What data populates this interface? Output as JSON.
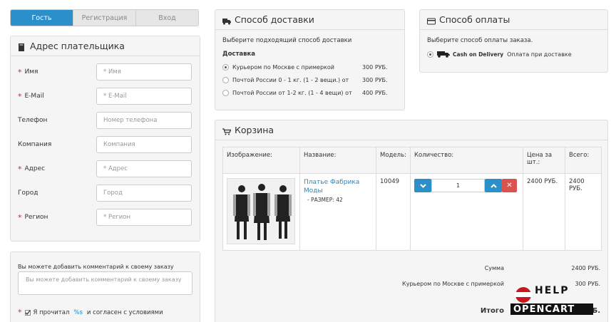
{
  "tabs": [
    "Гость",
    "Регистрация",
    "Вход"
  ],
  "payer": {
    "title": "Адрес плательщика",
    "fields": [
      {
        "label": "Имя",
        "required": true,
        "placeholder": "* Имя"
      },
      {
        "label": "E-Mail",
        "required": true,
        "placeholder": "* E-Mail"
      },
      {
        "label": "Телефон",
        "required": false,
        "placeholder": "Номер телефона"
      },
      {
        "label": "Компания",
        "required": false,
        "placeholder": "Компания"
      },
      {
        "label": "Адрес",
        "required": true,
        "placeholder": "* Адрес"
      },
      {
        "label": "Город",
        "required": false,
        "placeholder": "Город"
      },
      {
        "label": "Регион",
        "required": true,
        "placeholder": "* Регион"
      }
    ]
  },
  "comment": {
    "label": "Вы можете добавить комментарий к своему заказу",
    "placeholder": "Вы можете добавить комментарий к своему заказу",
    "agree_text": "Я прочитал",
    "agree_link": "%s",
    "agree_tail": "и согласен с условиями"
  },
  "delivery": {
    "title": "Способ доставки",
    "subtitle": "Выберите подходящий способ доставки",
    "group": "Доставка",
    "options": [
      {
        "label": "Курьером по Москве с примеркой",
        "price": "300 РУБ.",
        "selected": true
      },
      {
        "label": "Почтой России 0 - 1 кг. (1 - 2 вещи.) от",
        "price": "300 РУБ.",
        "selected": false
      },
      {
        "label": "Почтой России от 1-2 кг. (1 - 4 вещи) от",
        "price": "400 РУБ.",
        "selected": false
      }
    ]
  },
  "payment": {
    "title": "Способ оплаты",
    "subtitle": "Выберите способ оплаты заказа.",
    "option_logo": "Cash on Delivery",
    "option_label": "Оплата при доставке"
  },
  "cart": {
    "title": "Корзина",
    "headers": [
      "Изображение:",
      "Название:",
      "Модель:",
      "Количество:",
      "Цена за шт.:",
      "Всего:"
    ],
    "item": {
      "name": "Платье Фабрика Моды",
      "option": "- РАЗМЕР: 42",
      "model": "10049",
      "qty": "1",
      "price": "2400 РУБ.",
      "total": "2400 РУБ."
    },
    "totals": [
      {
        "label": "Сумма",
        "value": "2400 РУБ."
      },
      {
        "label": "Курьером по Москве с примеркой",
        "value": "300 РУБ."
      },
      {
        "label": "Итого",
        "value": "2700 РУБ."
      }
    ]
  },
  "watermark": {
    "line1": "HELP",
    "line2": "OPENCART"
  },
  "colors": {
    "accent": "#2b8fc9",
    "required": "#c9302c",
    "remove": "#d9534f",
    "link": "#2a86c4"
  }
}
